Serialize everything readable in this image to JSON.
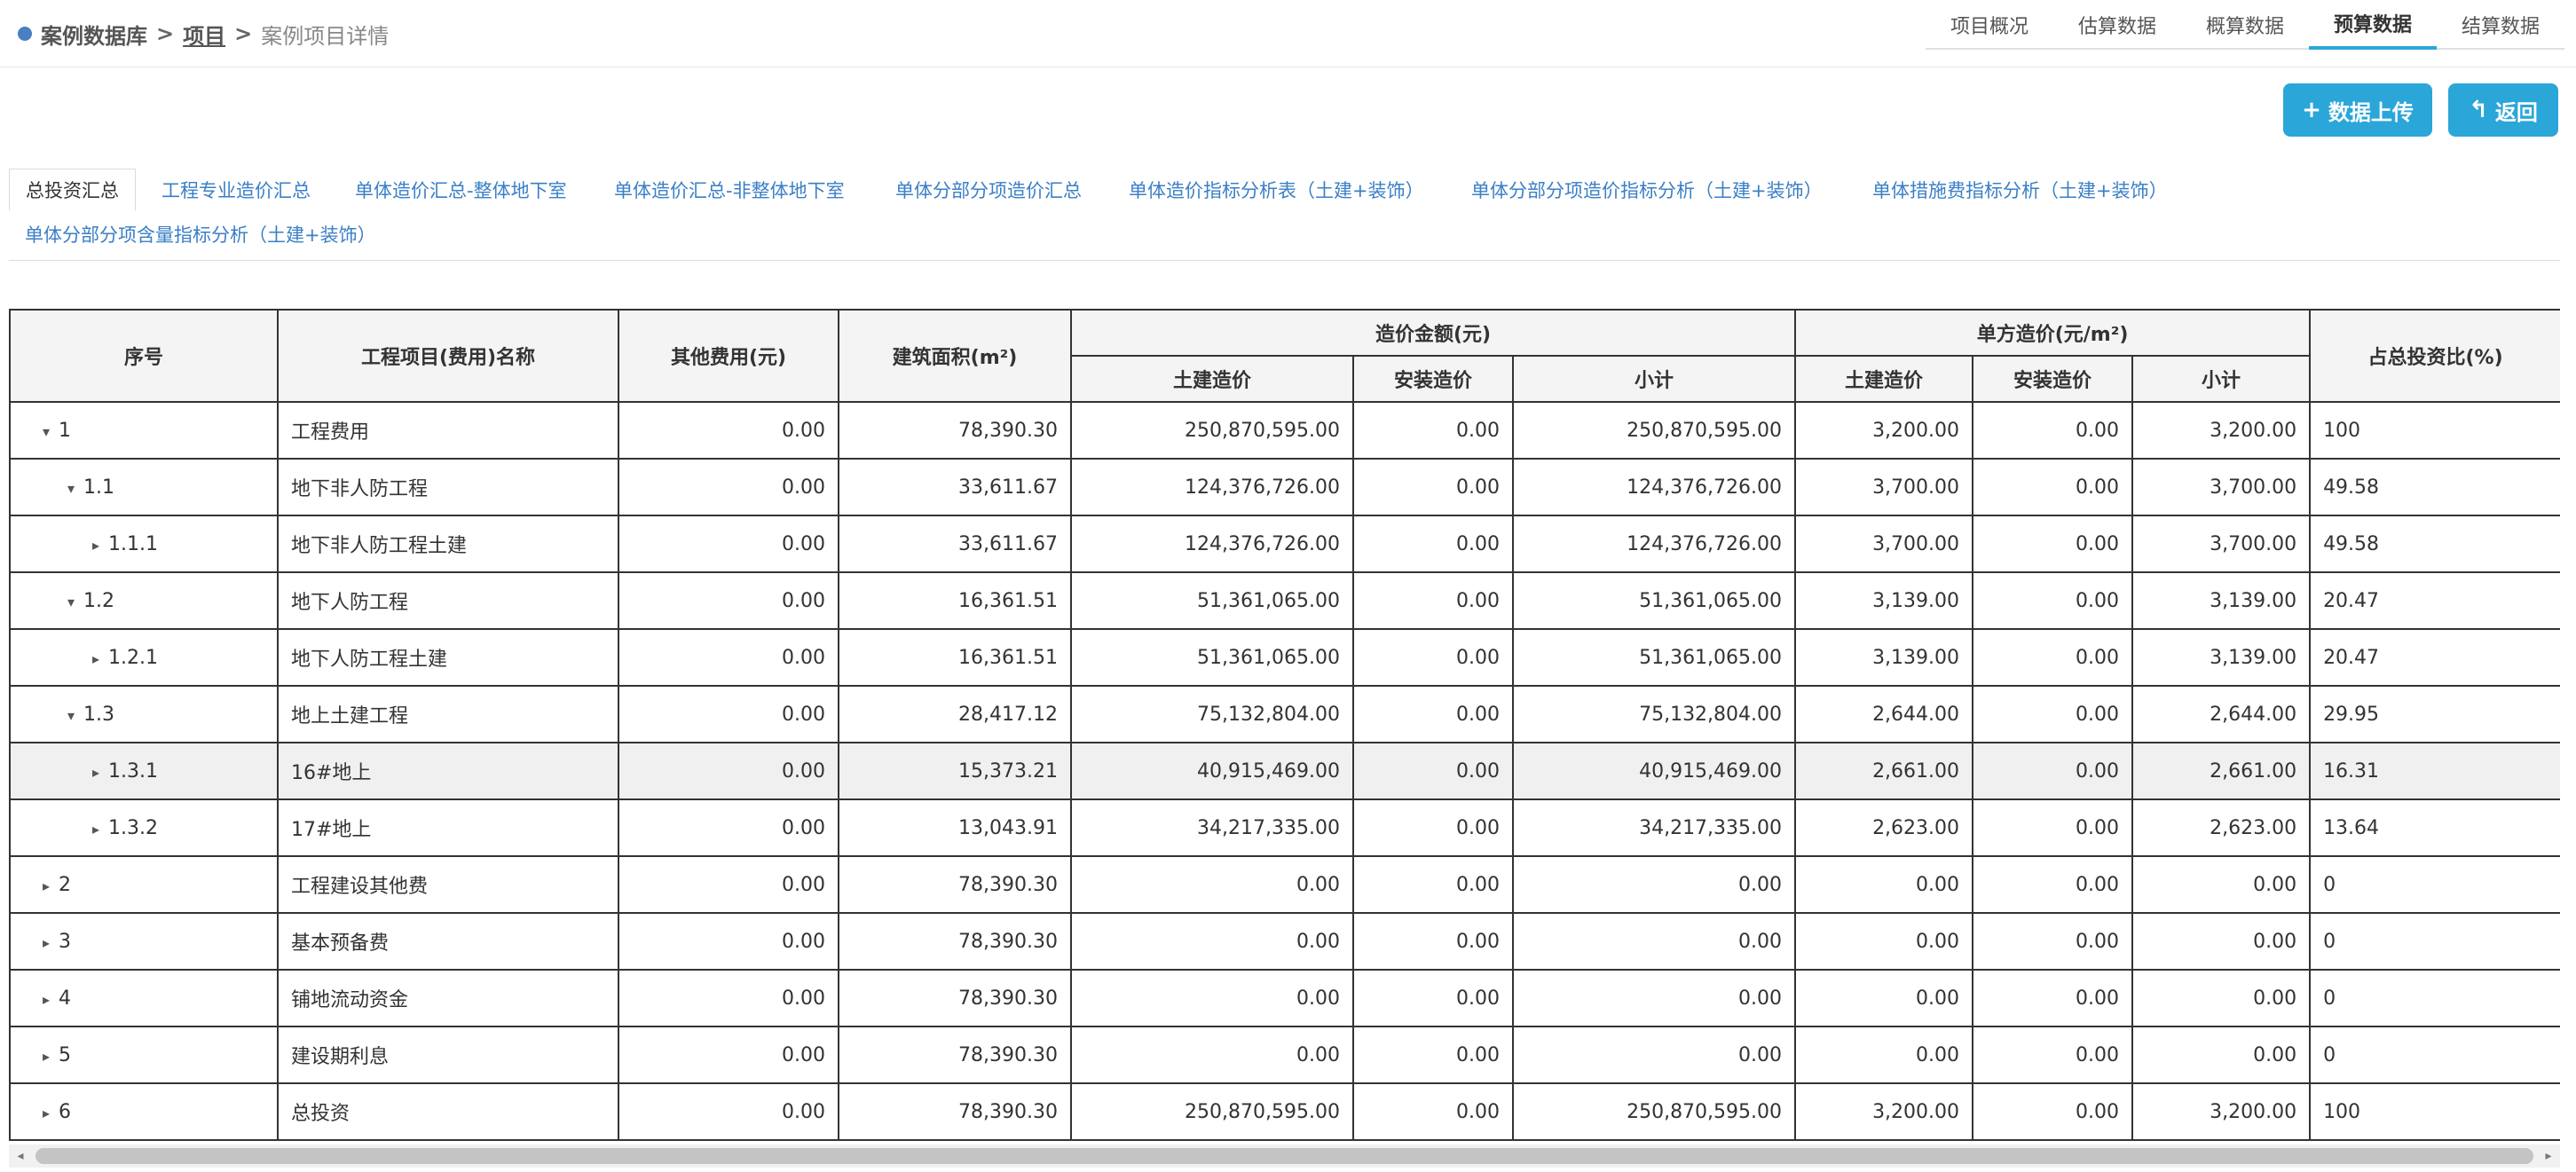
{
  "breadcrumb": {
    "home": "案例数据库",
    "sep": ">",
    "project": "项目",
    "current": "案例项目详情"
  },
  "topnav": [
    {
      "label": "项目概况",
      "active": false
    },
    {
      "label": "估算数据",
      "active": false
    },
    {
      "label": "概算数据",
      "active": false
    },
    {
      "label": "预算数据",
      "active": true
    },
    {
      "label": "结算数据",
      "active": false
    }
  ],
  "buttons": {
    "upload_icon": "+",
    "upload": "数据上传",
    "back_icon": "↰",
    "back": "返回"
  },
  "subtabs": [
    "总投资汇总",
    "工程专业造价汇总",
    "单体造价汇总-整体地下室",
    "单体造价汇总-非整体地下室",
    "单体分部分项造价汇总",
    "单体造价指标分析表（土建+装饰）",
    "单体分部分项造价指标分析（土建+装饰）",
    "单体措施费指标分析（土建+装饰）",
    "单体分部分项含量指标分析（土建+装饰）"
  ],
  "table": {
    "headers": {
      "seq": "序号",
      "name": "工程项目(费用)名称",
      "other": "其他费用(元)",
      "area": "建筑面积(m²)",
      "cost_group": "造价金额(元)",
      "unit_group": "单方造价(元/m²)",
      "ratio": "占总投资比(%)",
      "civil": "土建造价",
      "install": "安装造价",
      "subtotal": "小计"
    },
    "rows": [
      {
        "seq": "1",
        "caret": "▾",
        "name": "工程费用",
        "other": "0.00",
        "area": "78,390.30",
        "civil": "250,870,595.00",
        "install": "0.00",
        "subtotal": "250,870,595.00",
        "u_civil": "3,200.00",
        "u_install": "0.00",
        "u_subtotal": "3,200.00",
        "ratio": "100"
      },
      {
        "seq": "1.1",
        "caret": "▾",
        "name": "地下非人防工程",
        "other": "0.00",
        "area": "33,611.67",
        "civil": "124,376,726.00",
        "install": "0.00",
        "subtotal": "124,376,726.00",
        "u_civil": "3,700.00",
        "u_install": "0.00",
        "u_subtotal": "3,700.00",
        "ratio": "49.58"
      },
      {
        "seq": "1.1.1",
        "caret": "▸",
        "name": "地下非人防工程土建",
        "other": "0.00",
        "area": "33,611.67",
        "civil": "124,376,726.00",
        "install": "0.00",
        "subtotal": "124,376,726.00",
        "u_civil": "3,700.00",
        "u_install": "0.00",
        "u_subtotal": "3,700.00",
        "ratio": "49.58"
      },
      {
        "seq": "1.2",
        "caret": "▾",
        "name": "地下人防工程",
        "other": "0.00",
        "area": "16,361.51",
        "civil": "51,361,065.00",
        "install": "0.00",
        "subtotal": "51,361,065.00",
        "u_civil": "3,139.00",
        "u_install": "0.00",
        "u_subtotal": "3,139.00",
        "ratio": "20.47"
      },
      {
        "seq": "1.2.1",
        "caret": "▸",
        "name": "地下人防工程土建",
        "other": "0.00",
        "area": "16,361.51",
        "civil": "51,361,065.00",
        "install": "0.00",
        "subtotal": "51,361,065.00",
        "u_civil": "3,139.00",
        "u_install": "0.00",
        "u_subtotal": "3,139.00",
        "ratio": "20.47"
      },
      {
        "seq": "1.3",
        "caret": "▾",
        "name": "地上土建工程",
        "other": "0.00",
        "area": "28,417.12",
        "civil": "75,132,804.00",
        "install": "0.00",
        "subtotal": "75,132,804.00",
        "u_civil": "2,644.00",
        "u_install": "0.00",
        "u_subtotal": "2,644.00",
        "ratio": "29.95"
      },
      {
        "seq": "1.3.1",
        "caret": "▸",
        "name": "16#地上",
        "other": "0.00",
        "area": "15,373.21",
        "civil": "40,915,469.00",
        "install": "0.00",
        "subtotal": "40,915,469.00",
        "u_civil": "2,661.00",
        "u_install": "0.00",
        "u_subtotal": "2,661.00",
        "ratio": "16.31"
      },
      {
        "seq": "1.3.2",
        "caret": "▸",
        "name": "17#地上",
        "other": "0.00",
        "area": "13,043.91",
        "civil": "34,217,335.00",
        "install": "0.00",
        "subtotal": "34,217,335.00",
        "u_civil": "2,623.00",
        "u_install": "0.00",
        "u_subtotal": "2,623.00",
        "ratio": "13.64"
      },
      {
        "seq": "2",
        "caret": "▸",
        "name": "工程建设其他费",
        "other": "0.00",
        "area": "78,390.30",
        "civil": "0.00",
        "install": "0.00",
        "subtotal": "0.00",
        "u_civil": "0.00",
        "u_install": "0.00",
        "u_subtotal": "0.00",
        "ratio": "0"
      },
      {
        "seq": "3",
        "caret": "▸",
        "name": "基本预备费",
        "other": "0.00",
        "area": "78,390.30",
        "civil": "0.00",
        "install": "0.00",
        "subtotal": "0.00",
        "u_civil": "0.00",
        "u_install": "0.00",
        "u_subtotal": "0.00",
        "ratio": "0"
      },
      {
        "seq": "4",
        "caret": "▸",
        "name": "铺地流动资金",
        "other": "0.00",
        "area": "78,390.30",
        "civil": "0.00",
        "install": "0.00",
        "subtotal": "0.00",
        "u_civil": "0.00",
        "u_install": "0.00",
        "u_subtotal": "0.00",
        "ratio": "0"
      },
      {
        "seq": "5",
        "caret": "▸",
        "name": "建设期利息",
        "other": "0.00",
        "area": "78,390.30",
        "civil": "0.00",
        "install": "0.00",
        "subtotal": "0.00",
        "u_civil": "0.00",
        "u_install": "0.00",
        "u_subtotal": "0.00",
        "ratio": "0"
      },
      {
        "seq": "6",
        "caret": "▸",
        "name": "总投资",
        "other": "0.00",
        "area": "78,390.30",
        "civil": "250,870,595.00",
        "install": "0.00",
        "subtotal": "250,870,595.00",
        "u_civil": "3,200.00",
        "u_install": "0.00",
        "u_subtotal": "3,200.00",
        "ratio": "100"
      }
    ]
  },
  "scrollbar": {
    "left_icon": "◂",
    "right_icon": "▸"
  },
  "colors": {
    "accent": "#2ba6d9",
    "link": "#3a7fc6",
    "highlight_row": "#f0f0f0"
  }
}
